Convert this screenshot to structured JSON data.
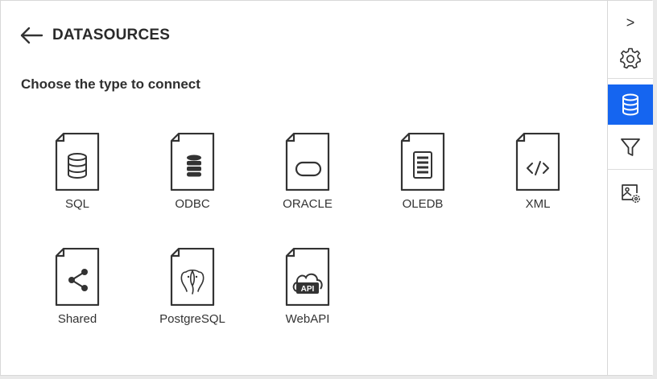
{
  "header": {
    "title": "DATASOURCES"
  },
  "subtitle": "Choose the type to connect",
  "datasources": [
    {
      "label": "SQL",
      "icon": "sql-database-icon"
    },
    {
      "label": "ODBC",
      "icon": "odbc-database-icon"
    },
    {
      "label": "ORACLE",
      "icon": "oracle-icon"
    },
    {
      "label": "OLEDB",
      "icon": "oledb-icon"
    },
    {
      "label": "XML",
      "icon": "xml-code-icon"
    },
    {
      "label": "Shared",
      "icon": "share-icon"
    },
    {
      "label": "PostgreSQL",
      "icon": "postgresql-elephant-icon"
    },
    {
      "label": "WebAPI",
      "icon": "web-api-cloud-icon"
    }
  ],
  "rail": {
    "collapse": {
      "label": ">"
    },
    "items": [
      {
        "icon": "gear-icon",
        "active": false
      },
      {
        "icon": "database-icon",
        "active": true
      },
      {
        "icon": "filter-icon",
        "active": false
      },
      {
        "icon": "image-settings-icon",
        "active": false
      }
    ]
  },
  "colors": {
    "accent": "#1565f0",
    "text": "#2f2f2f",
    "icon_stroke": "#333333"
  }
}
